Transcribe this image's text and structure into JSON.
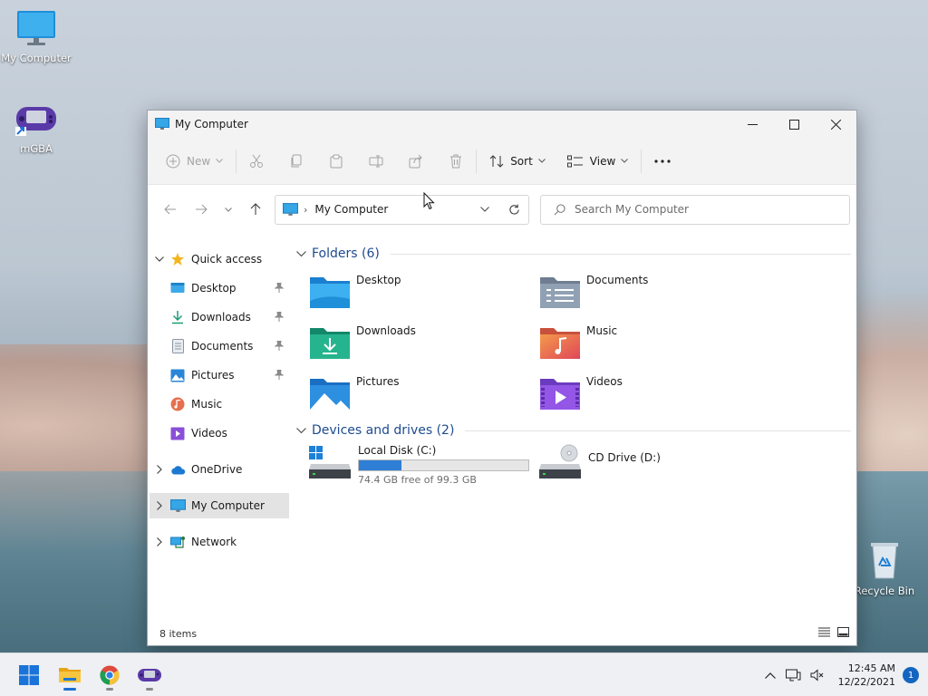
{
  "desktop": {
    "icons": [
      {
        "label": "My Computer"
      },
      {
        "label": "mGBA"
      },
      {
        "label": "Recycle Bin"
      }
    ]
  },
  "window": {
    "title": "My Computer",
    "toolbar": {
      "new_label": "New",
      "sort_label": "Sort",
      "view_label": "View"
    },
    "address": {
      "crumb": "My Computer"
    },
    "search": {
      "placeholder": "Search My Computer"
    },
    "nav": {
      "quick_access": "Quick access",
      "items": [
        {
          "label": "Desktop"
        },
        {
          "label": "Downloads"
        },
        {
          "label": "Documents"
        },
        {
          "label": "Pictures"
        },
        {
          "label": "Music"
        },
        {
          "label": "Videos"
        }
      ],
      "onedrive": "OneDrive",
      "my_computer": "My Computer",
      "network": "Network"
    },
    "folders_header": "Folders (6)",
    "folders": [
      {
        "label": "Desktop"
      },
      {
        "label": "Documents"
      },
      {
        "label": "Downloads"
      },
      {
        "label": "Music"
      },
      {
        "label": "Pictures"
      },
      {
        "label": "Videos"
      }
    ],
    "drives_header": "Devices and drives (2)",
    "drives": [
      {
        "label": "Local Disk (C:)",
        "free_text": "74.4 GB free of 99.3 GB",
        "used_fraction": 0.25
      },
      {
        "label": "CD Drive (D:)"
      }
    ],
    "status": {
      "item_count": "8 items"
    }
  },
  "taskbar": {
    "clock_time": "12:45 AM",
    "clock_date": "12/22/2021",
    "notification_count": "1"
  },
  "colors": {
    "accent": "#2f7fd6",
    "group_header": "#1e4b8f",
    "selection": "#e3e3e3"
  }
}
